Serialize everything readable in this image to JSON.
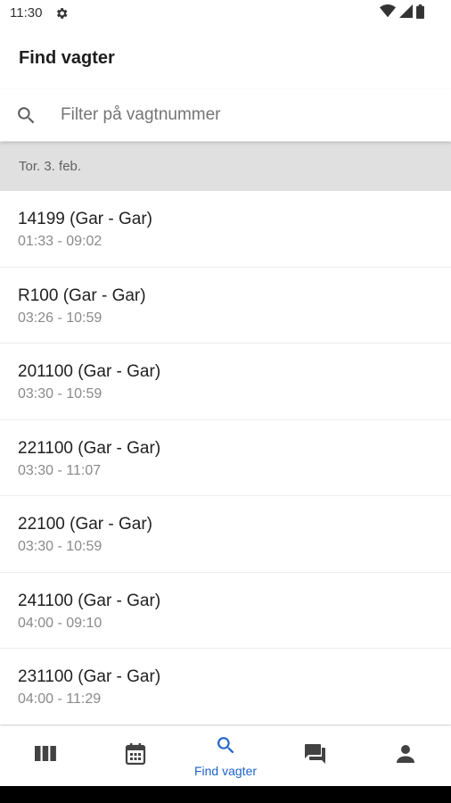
{
  "status_bar": {
    "time": "11:30",
    "icons": [
      "gear-icon",
      "wifi-icon",
      "signal-icon",
      "battery-icon"
    ]
  },
  "header": {
    "title": "Find vagter"
  },
  "search": {
    "placeholder": "Filter på vagtnummer",
    "value": ""
  },
  "date_header": "Tor. 3. feb.",
  "shifts": [
    {
      "title": "14199 (Gar - Gar)",
      "time": "01:33 - 09:02"
    },
    {
      "title": "R100 (Gar - Gar)",
      "time": "03:26 - 10:59"
    },
    {
      "title": "201100 (Gar - Gar)",
      "time": "03:30 - 10:59"
    },
    {
      "title": "221100 (Gar - Gar)",
      "time": "03:30 - 11:07"
    },
    {
      "title": "22100 (Gar - Gar)",
      "time": "03:30 - 10:59"
    },
    {
      "title": "241100 (Gar - Gar)",
      "time": "04:00 - 09:10"
    },
    {
      "title": "231100 (Gar - Gar)",
      "time": "04:00 - 11:29"
    }
  ],
  "bottom_nav": {
    "items": [
      {
        "icon": "columns-icon",
        "label": "",
        "active": false
      },
      {
        "icon": "calendar-icon",
        "label": "",
        "active": false
      },
      {
        "icon": "search-icon",
        "label": "Find vagter",
        "active": true
      },
      {
        "icon": "chat-icon",
        "label": "",
        "active": false
      },
      {
        "icon": "person-icon",
        "label": "",
        "active": false
      }
    ]
  },
  "colors": {
    "accent": "#1e63c7",
    "inactive_icon": "#424242",
    "date_header_bg": "#e0e0e0"
  }
}
